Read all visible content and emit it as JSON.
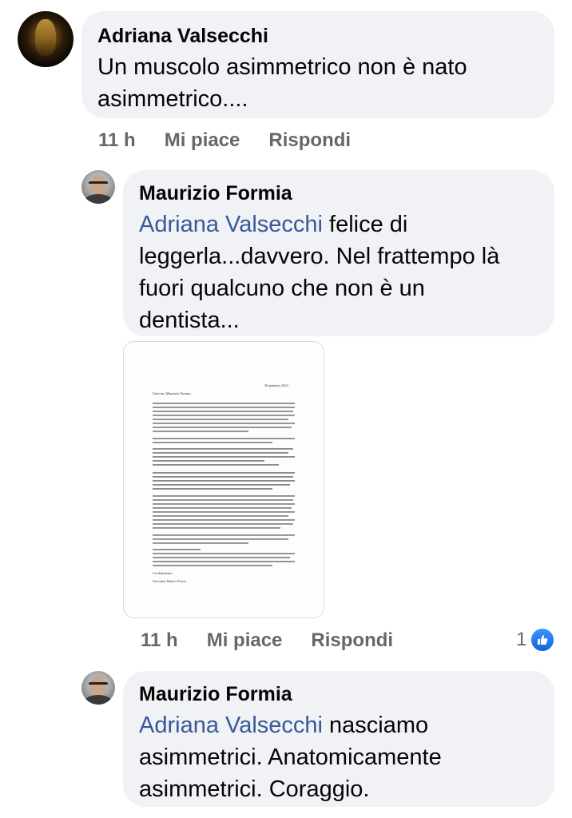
{
  "comments": [
    {
      "author": "Adriana Valsecchi",
      "text_lines": [
        "Un muscolo asimmetrico non è nato",
        "asimmetrico...."
      ],
      "time": "11 h",
      "like_label": "Mi piace",
      "reply_label": "Rispondi"
    },
    {
      "author": "Maurizio Formia",
      "mention": "Adriana Valsecchi",
      "text_lines": [
        " felice di",
        "leggerla...davvero. Nel frattempo là",
        "fuori qualcuno che non è un",
        "dentista..."
      ],
      "attachment": {
        "date": "30 gennaio 2022",
        "greeting": "Gent.mo Maurizio Formia,",
        "closing": "Cordialmente",
        "signature": "Giovanni Mauro Prima"
      },
      "time": "11 h",
      "like_label": "Mi piace",
      "reply_label": "Rispondi",
      "like_count": "1"
    },
    {
      "author": "Maurizio Formia",
      "mention": "Adriana Valsecchi",
      "text_lines": [
        " nasciamo",
        "asimmetrici. Anatomicamente",
        "asimmetrici. Coraggio."
      ]
    }
  ],
  "icons": {
    "avatar_1": "profile-photo-golden-figure",
    "avatar_2": "profile-photo-man-glasses",
    "like_reaction": "thumbs-up-icon"
  },
  "colors": {
    "bubble": "#f0f2f5",
    "mention": "#385898",
    "meta": "#65676b",
    "like_blue": "#1877f2"
  }
}
